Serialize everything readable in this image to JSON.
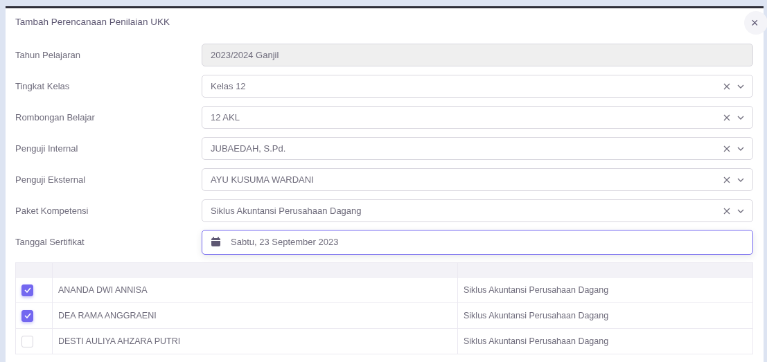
{
  "dialog": {
    "title": "Tambah Perencanaan Penilaian UKK",
    "close": "×"
  },
  "fields": [
    {
      "label": "Tahun Pelajaran",
      "kind": "text",
      "value": "2023/2024 Ganjil",
      "disabled": true,
      "focused": false
    },
    {
      "label": "Tingkat Kelas",
      "kind": "select",
      "value": "Kelas 12",
      "disabled": false,
      "focused": false
    },
    {
      "label": "Rombongan Belajar",
      "kind": "select",
      "value": "12 AKL",
      "disabled": false,
      "focused": false
    },
    {
      "label": "Penguji Internal",
      "kind": "select",
      "value": "JUBAEDAH, S.Pd.",
      "disabled": false,
      "focused": false
    },
    {
      "label": "Penguji Eksternal",
      "kind": "select",
      "value": "AYU KUSUMA WARDANI",
      "disabled": false,
      "focused": false
    },
    {
      "label": "Paket Kompetensi",
      "kind": "select",
      "value": "Siklus Akuntansi Perusahaan Dagang",
      "disabled": false,
      "focused": false
    },
    {
      "label": "Tanggal Sertifikat",
      "kind": "date",
      "value": "Sabtu, 23 September 2023",
      "disabled": false,
      "focused": true
    }
  ],
  "table": {
    "rows": [
      {
        "checked": true,
        "name": "ANANDA DWI ANNISA",
        "package": "Siklus Akuntansi Perusahaan Dagang"
      },
      {
        "checked": true,
        "name": "DEA RAMA ANGGRAENI",
        "package": "Siklus Akuntansi Perusahaan Dagang"
      },
      {
        "checked": false,
        "name": "DESTI AULIYA AHZARA PUTRI",
        "package": "Siklus Akuntansi Perusahaan Dagang"
      }
    ]
  }
}
